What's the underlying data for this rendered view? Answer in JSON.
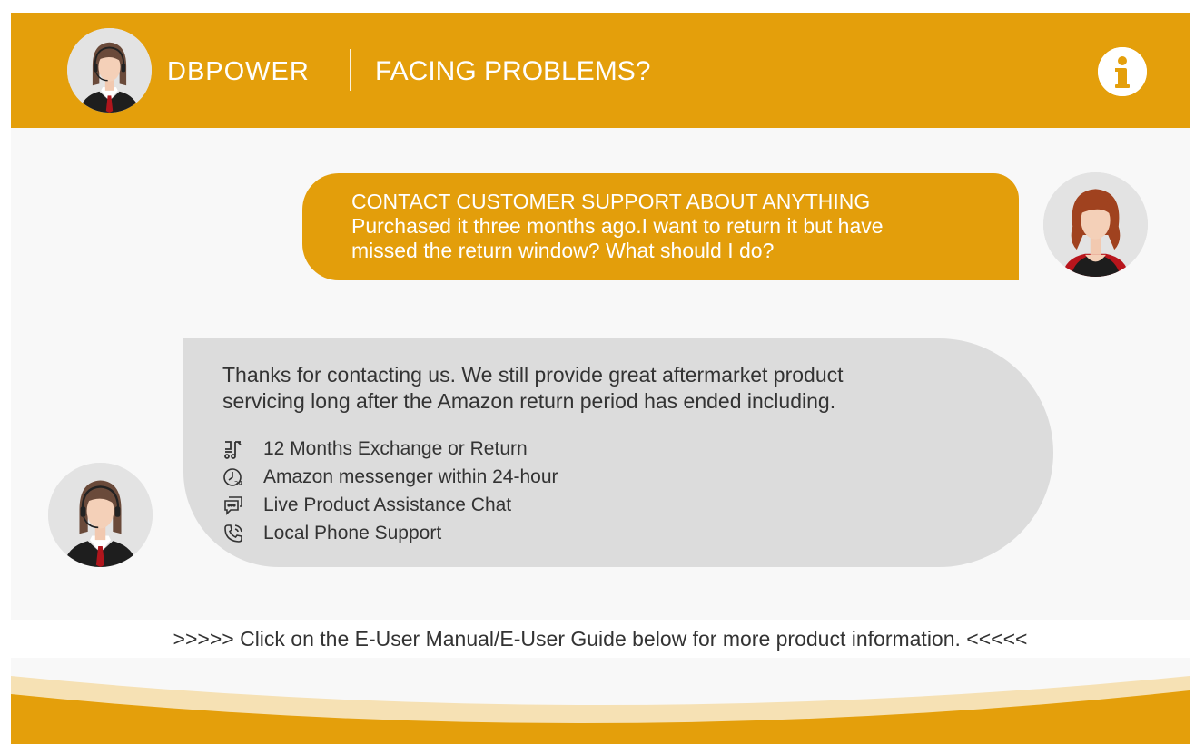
{
  "header": {
    "brand": "DBPOWER",
    "headline": "FACING PROBLEMS?",
    "info_icon": "info-icon"
  },
  "user_message": {
    "line1": "CONTACT CUSTOMER SUPPORT ABOUT ANYTHING",
    "line2": "Purchased it three months ago.I want to return it but have",
    "line3": "missed the return window? What should I do?"
  },
  "agent_message": {
    "line1": "Thanks for contacting us. We still provide great aftermarket product",
    "line2": "servicing long after the Amazon return period has ended including.",
    "features": [
      {
        "icon": "cart-return-icon",
        "label": "12 Months Exchange or Return"
      },
      {
        "icon": "clock-24-icon",
        "label": "Amazon messenger within 24-hour"
      },
      {
        "icon": "chat-bubble-icon",
        "label": "Live Product Assistance Chat"
      },
      {
        "icon": "phone-icon",
        "label": "Local Phone Support"
      }
    ]
  },
  "notice": ">>>>> Click on the E-User Manual/E-User Guide below for more product information. <<<<<",
  "colors": {
    "accent": "#e49f0b",
    "agent_bubble": "#dcdcdc",
    "background": "#f8f8f8",
    "text": "#333333"
  }
}
